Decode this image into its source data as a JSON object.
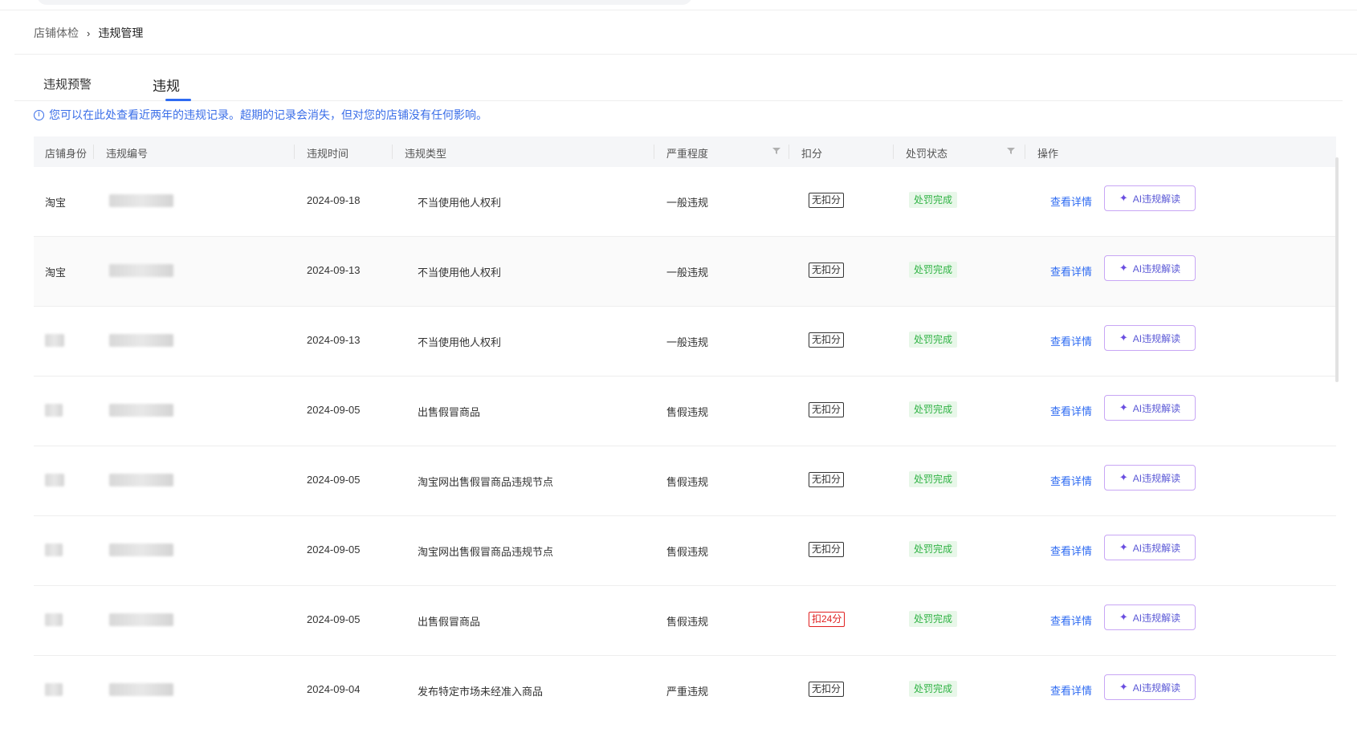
{
  "breadcrumb": {
    "parent": "店铺体检",
    "separator": "›",
    "current": "违规管理"
  },
  "tabs": [
    {
      "label": "违规预警",
      "active": false
    },
    {
      "label": "违规",
      "active": true
    }
  ],
  "notice": {
    "icon": "info-icon",
    "text": "您可以在此处查看近两年的违规记录。超期的记录会消失，但对您的店铺没有任何影响。"
  },
  "table": {
    "headers": {
      "shop_identity": "店铺身份",
      "violation_id": "违规编号",
      "violation_time": "违规时间",
      "violation_type": "违规类型",
      "severity": "严重程度",
      "deduction": "扣分",
      "penalty_status": "处罚状态",
      "actions": "操作"
    },
    "rows": [
      {
        "shop": "淘宝",
        "date": "2024-09-18",
        "type": "不当使用他人权利",
        "severity": "一般违规",
        "deduction": "无扣分",
        "deduction_level": "none",
        "status": "处罚完成",
        "detail": "查看详情",
        "ai": "AI违规解读"
      },
      {
        "shop": "淘宝",
        "date": "2024-09-13",
        "type": "不当使用他人权利",
        "severity": "一般违规",
        "deduction": "无扣分",
        "deduction_level": "none",
        "status": "处罚完成",
        "detail": "查看详情",
        "ai": "AI违规解读"
      },
      {
        "shop": "",
        "date": "2024-09-13",
        "type": "不当使用他人权利",
        "severity": "一般违规",
        "deduction": "无扣分",
        "deduction_level": "none",
        "status": "处罚完成",
        "detail": "查看详情",
        "ai": "AI违规解读"
      },
      {
        "shop": "",
        "date": "2024-09-05",
        "type": "出售假冒商品",
        "severity": "售假违规",
        "deduction": "无扣分",
        "deduction_level": "none",
        "status": "处罚完成",
        "detail": "查看详情",
        "ai": "AI违规解读"
      },
      {
        "shop": "",
        "date": "2024-09-05",
        "type": "淘宝网出售假冒商品违规节点",
        "severity": "售假违规",
        "deduction": "无扣分",
        "deduction_level": "none",
        "status": "处罚完成",
        "detail": "查看详情",
        "ai": "AI违规解读"
      },
      {
        "shop": "",
        "date": "2024-09-05",
        "type": "淘宝网出售假冒商品违规节点",
        "severity": "售假违规",
        "deduction": "无扣分",
        "deduction_level": "none",
        "status": "处罚完成",
        "detail": "查看详情",
        "ai": "AI违规解读"
      },
      {
        "shop": "",
        "date": "2024-09-05",
        "type": "出售假冒商品",
        "severity": "售假违规",
        "deduction": "扣24分",
        "deduction_level": "penalty",
        "status": "处罚完成",
        "detail": "查看详情",
        "ai": "AI违规解读"
      },
      {
        "shop": "",
        "date": "2024-09-04",
        "type": "发布特定市场未经准入商品",
        "severity": "严重违规",
        "deduction": "无扣分",
        "deduction_level": "none",
        "status": "处罚完成",
        "detail": "查看详情",
        "ai": "AI违规解读"
      }
    ]
  },
  "colors": {
    "accent": "#2e6bf2",
    "status_green": "#2fb344",
    "status_green_bg": "#e8f7e9",
    "penalty_red": "#e02020",
    "ai_border": "#c8a6f5"
  }
}
